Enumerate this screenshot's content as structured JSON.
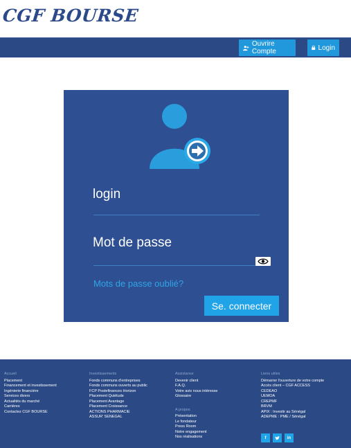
{
  "brand": {
    "logo_text": "CGF BOURSE"
  },
  "nav": {
    "open_account_label": "Ouvrire Compte",
    "login_label": "Login"
  },
  "login_form": {
    "login_label": "login",
    "password_label": "Mot de passe",
    "forgot_label": "Mots de passe oublié?",
    "submit_label": "Se. connecter"
  },
  "footer": {
    "columns": [
      {
        "heading": "Accueil",
        "items": [
          "Placement",
          "Financement et investissement",
          "Ingénierie financière",
          "Services divers",
          "Actualités du marché",
          "Carrières",
          "Contactez CGF BOURSE"
        ]
      },
      {
        "heading": "Investissements",
        "items": [
          "Fonds communs d'entreprises",
          "Fonds communs ouverts au public",
          "FCP Postefinances Horizon",
          "Placement Quiétude",
          "Placement Avantage",
          "Placement Croissance",
          "ACTIONS PHARMACIE",
          "ASSUR' SENEGAL"
        ]
      },
      {
        "heading": "Assistance",
        "items": [
          "Devenir client",
          "F.A.Q.",
          "Votre avis nous intéresse",
          "Glossaire"
        ],
        "sub_heading": "A propos",
        "sub_items": [
          "Présentation",
          "Le fondateur",
          "Press Room",
          "Notre engagement",
          "Nos réalisations"
        ]
      },
      {
        "heading": "Liens utiles",
        "items": [
          "Démarrer l'ouverture de votre compte",
          "Accès client – CGF ACCESS",
          "CEDEAO",
          "UEMOA",
          "CREPMF",
          "BRVM",
          "APIX : Investir au Sénégal",
          "ADEPME : PME / Sénégal"
        ]
      }
    ],
    "social": {
      "facebook": "f",
      "twitter": "t",
      "linkedin": "in"
    }
  }
}
